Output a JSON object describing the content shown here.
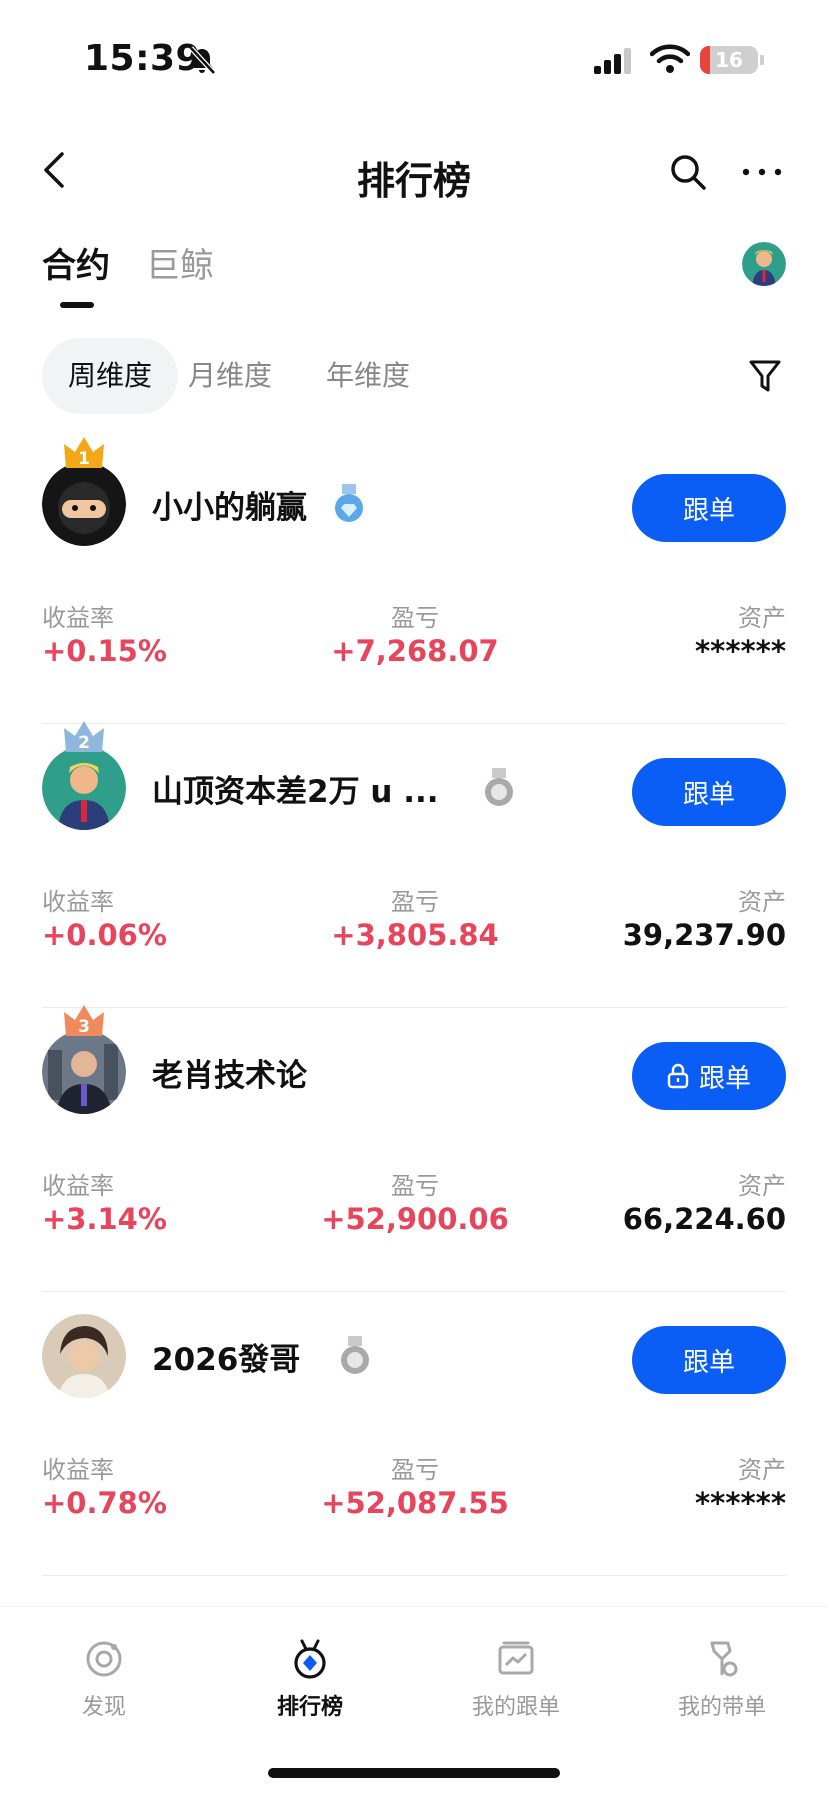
{
  "status": {
    "time": "15:39",
    "battery": "16"
  },
  "header": {
    "title": "排行榜"
  },
  "tabs": [
    {
      "label": "合约"
    },
    {
      "label": "巨鲸"
    }
  ],
  "periods": [
    {
      "label": "周维度"
    },
    {
      "label": "月维度"
    },
    {
      "label": "年维度"
    }
  ],
  "stat_labels": {
    "rate": "收益率",
    "pnl": "盈亏",
    "assets": "资产"
  },
  "traders": [
    {
      "rank": "1",
      "name": "小小的躺赢",
      "medal": "gem-medal",
      "follow_label": "跟单",
      "locked": false,
      "rate": "+0.15%",
      "pnl": "+7,268.07",
      "assets": "******"
    },
    {
      "rank": "2",
      "name": "山顶资本差2万 u ...",
      "medal": "silver-medal",
      "follow_label": "跟单",
      "locked": false,
      "rate": "+0.06%",
      "pnl": "+3,805.84",
      "assets": "39,237.90"
    },
    {
      "rank": "3",
      "name": "老肖技术论",
      "medal": "",
      "follow_label": "跟单",
      "locked": true,
      "rate": "+3.14%",
      "pnl": "+52,900.06",
      "assets": "66,224.60"
    },
    {
      "rank": "",
      "name": "2026發哥",
      "medal": "silver-medal",
      "follow_label": "跟单",
      "locked": false,
      "rate": "+0.78%",
      "pnl": "+52,087.55",
      "assets": "******"
    }
  ],
  "nav": [
    {
      "label": "发现",
      "icon": "discover-icon"
    },
    {
      "label": "排行榜",
      "icon": "leaderboard-icon"
    },
    {
      "label": "我的跟单",
      "icon": "my-follow-icon"
    },
    {
      "label": "我的带单",
      "icon": "my-lead-icon"
    }
  ],
  "colors": {
    "accent": "#0b5ef5",
    "profit": "#e8455c",
    "gold": "#f2a818",
    "silver": "#8fb6dd",
    "bronze": "#f08a5d"
  }
}
